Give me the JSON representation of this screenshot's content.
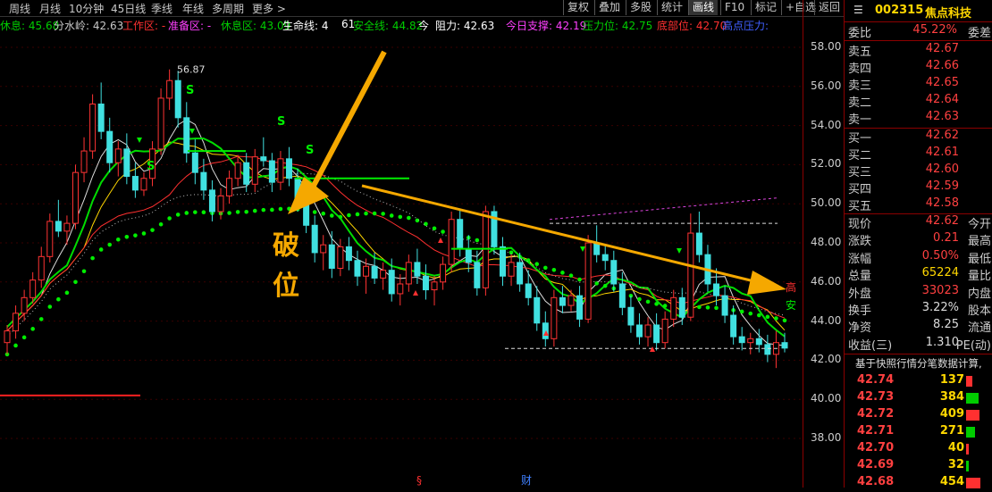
{
  "toolbar": {
    "left": [
      "周线",
      "月线",
      "10分钟",
      "45日线",
      "季线",
      "年线",
      "多周期",
      "更多 >"
    ],
    "right": [
      "复权",
      "叠加",
      "多股",
      "统计",
      "画线",
      "F10",
      "标记",
      "+自选",
      "返回"
    ],
    "active": "画线"
  },
  "indicators": [
    {
      "label": "休息: 45.68",
      "color": "#00cc00"
    },
    {
      "label": "分水岭: 42.63",
      "color": "#c8c8c8"
    },
    {
      "label": "工作区: -",
      "color": "#ff3030"
    },
    {
      "label": "准备区: -",
      "color": "#ff40ff"
    },
    {
      "label": "休息区: 43.09",
      "color": "#00cc00"
    },
    {
      "label": "生命线: 4",
      "color": "#ffffff"
    },
    {
      "label": "61",
      "color": "#ffffff"
    },
    {
      "label": "安全线: 44.82",
      "color": "#00cc00"
    },
    {
      "label": "今",
      "color": "#ffffff"
    },
    {
      "label": "阻力: 42.63",
      "color": "#ffffff"
    },
    {
      "label": "今日支撑: 42.19",
      "color": "#ff40ff"
    },
    {
      "label": "压力位: 42.75",
      "color": "#00cc00"
    },
    {
      "label": "底部位: 42.70",
      "color": "#ff3030"
    },
    {
      "label": "高点压力:",
      "color": "#4060ff"
    }
  ],
  "annotation": {
    "text1": "破",
    "text2": "位",
    "high_label": "高",
    "safe_label": "安"
  },
  "chart_data": {
    "type": "candlestick",
    "ylim": [
      37,
      59
    ],
    "yticks": [
      "58.00",
      "56.00",
      "54.00",
      "52.00",
      "50.00",
      "48.00",
      "46.00",
      "44.00",
      "42.00",
      "40.00",
      "38.00"
    ],
    "high_marker": "56.87",
    "bottom_markers": [
      "§",
      "财"
    ],
    "candles": [
      [
        42.9,
        43.8,
        42.3,
        43.5
      ],
      [
        43.5,
        44.8,
        43.1,
        44.4
      ],
      [
        44.4,
        45.6,
        44.0,
        45.2
      ],
      [
        45.2,
        46.5,
        44.9,
        46.1
      ],
      [
        46.1,
        47.8,
        45.7,
        47.3
      ],
      [
        47.3,
        49.5,
        47.0,
        49.1
      ],
      [
        49.1,
        50.2,
        48.3,
        48.6
      ],
      [
        48.6,
        49.4,
        47.9,
        49.0
      ],
      [
        49.0,
        52.0,
        48.7,
        51.6
      ],
      [
        51.6,
        53.4,
        51.1,
        52.7
      ],
      [
        52.7,
        55.6,
        52.3,
        55.1
      ],
      [
        55.1,
        56.2,
        53.3,
        53.7
      ],
      [
        53.7,
        54.4,
        51.6,
        52.1
      ],
      [
        52.1,
        53.2,
        51.4,
        52.8
      ],
      [
        52.8,
        53.6,
        51.0,
        51.4
      ],
      [
        51.4,
        52.1,
        50.3,
        50.7
      ],
      [
        50.7,
        51.6,
        50.4,
        51.3
      ],
      [
        51.3,
        53.2,
        50.9,
        52.8
      ],
      [
        52.8,
        55.9,
        52.5,
        55.4
      ],
      [
        55.4,
        56.87,
        54.8,
        56.3
      ],
      [
        56.3,
        56.8,
        53.9,
        54.4
      ],
      [
        54.4,
        55.2,
        52.1,
        52.6
      ],
      [
        52.6,
        53.3,
        51.0,
        51.6
      ],
      [
        51.6,
        52.3,
        50.2,
        50.7
      ],
      [
        50.7,
        51.2,
        49.1,
        49.6
      ],
      [
        49.6,
        50.8,
        49.2,
        50.4
      ],
      [
        50.4,
        51.7,
        50.0,
        51.3
      ],
      [
        51.3,
        52.5,
        50.9,
        52.1
      ],
      [
        52.1,
        52.6,
        50.6,
        51.0
      ],
      [
        51.0,
        52.8,
        50.6,
        52.4
      ],
      [
        52.4,
        53.4,
        51.9,
        52.2
      ],
      [
        52.2,
        52.6,
        50.6,
        51.1
      ],
      [
        51.1,
        52.7,
        50.7,
        52.3
      ],
      [
        52.3,
        52.9,
        50.9,
        51.3
      ],
      [
        51.3,
        51.8,
        49.6,
        50.1
      ],
      [
        50.1,
        50.6,
        48.5,
        48.9
      ],
      [
        48.9,
        49.4,
        47.0,
        47.5
      ],
      [
        47.5,
        48.4,
        46.6,
        47.9
      ],
      [
        47.9,
        48.6,
        46.2,
        46.7
      ],
      [
        46.7,
        48.2,
        46.3,
        47.8
      ],
      [
        47.8,
        48.3,
        46.6,
        47.1
      ],
      [
        47.1,
        47.6,
        45.8,
        46.3
      ],
      [
        46.3,
        47.2,
        45.4,
        46.8
      ],
      [
        46.8,
        47.5,
        45.9,
        46.2
      ],
      [
        46.2,
        47.0,
        45.6,
        46.6
      ],
      [
        46.6,
        47.2,
        45.0,
        45.4
      ],
      [
        45.4,
        46.4,
        44.8,
        45.9
      ],
      [
        45.9,
        47.4,
        45.5,
        47.0
      ],
      [
        47.0,
        47.7,
        45.9,
        46.3
      ],
      [
        46.3,
        46.9,
        45.1,
        45.6
      ],
      [
        45.6,
        46.3,
        44.8,
        46.0
      ],
      [
        46.0,
        47.3,
        45.6,
        46.9
      ],
      [
        46.9,
        49.6,
        46.5,
        49.2
      ],
      [
        49.2,
        49.7,
        47.3,
        47.7
      ],
      [
        47.7,
        48.4,
        46.5,
        47.0
      ],
      [
        47.0,
        47.6,
        45.3,
        45.7
      ],
      [
        45.7,
        49.9,
        45.3,
        49.6
      ],
      [
        49.6,
        49.9,
        47.4,
        47.8
      ],
      [
        47.8,
        48.3,
        45.8,
        46.3
      ],
      [
        46.3,
        47.4,
        45.8,
        47.0
      ],
      [
        47.0,
        47.5,
        45.5,
        45.9
      ],
      [
        45.9,
        46.6,
        44.8,
        45.2
      ],
      [
        45.2,
        45.8,
        43.5,
        43.9
      ],
      [
        43.9,
        44.5,
        42.7,
        43.1
      ],
      [
        43.1,
        45.6,
        42.7,
        45.2
      ],
      [
        45.2,
        45.8,
        44.4,
        44.8
      ],
      [
        44.8,
        45.6,
        44.5,
        45.3
      ],
      [
        45.3,
        45.8,
        43.7,
        44.1
      ],
      [
        44.1,
        48.4,
        43.9,
        48.0
      ],
      [
        48.0,
        48.9,
        47.0,
        47.4
      ],
      [
        47.4,
        47.9,
        46.6,
        47.1
      ],
      [
        47.1,
        47.6,
        45.5,
        45.9
      ],
      [
        45.9,
        46.5,
        44.3,
        44.7
      ],
      [
        44.7,
        45.3,
        43.4,
        43.8
      ],
      [
        43.8,
        44.4,
        42.8,
        43.2
      ],
      [
        43.2,
        44.2,
        42.7,
        43.8
      ],
      [
        43.8,
        44.4,
        42.5,
        42.9
      ],
      [
        42.9,
        44.5,
        42.6,
        44.1
      ],
      [
        44.1,
        45.6,
        43.7,
        45.2
      ],
      [
        45.2,
        45.7,
        43.8,
        44.2
      ],
      [
        44.2,
        49.5,
        44.0,
        48.5
      ],
      [
        48.5,
        49.6,
        47.0,
        47.4
      ],
      [
        47.4,
        47.9,
        45.5,
        45.9
      ],
      [
        45.9,
        46.7,
        44.8,
        45.3
      ],
      [
        45.3,
        45.8,
        43.9,
        44.3
      ],
      [
        44.3,
        44.8,
        42.8,
        43.2
      ],
      [
        43.2,
        43.7,
        42.5,
        42.9
      ],
      [
        42.9,
        43.4,
        42.3,
        43.1
      ],
      [
        43.1,
        43.6,
        42.4,
        42.8
      ],
      [
        42.8,
        43.3,
        41.9,
        42.3
      ],
      [
        42.3,
        43.5,
        41.6,
        42.9
      ],
      [
        42.9,
        43.4,
        42.4,
        42.62
      ]
    ]
  },
  "panel": {
    "code": "002315",
    "name": "焦点科技",
    "weibi_label": "委比",
    "weibi": "45.22%",
    "weicha_label": "委差",
    "asks": [
      [
        "卖五",
        "42.67"
      ],
      [
        "卖四",
        "42.66"
      ],
      [
        "卖三",
        "42.65"
      ],
      [
        "卖二",
        "42.64"
      ],
      [
        "卖一",
        "42.63"
      ]
    ],
    "bids": [
      [
        "买一",
        "42.62"
      ],
      [
        "买二",
        "42.61"
      ],
      [
        "买三",
        "42.60"
      ],
      [
        "买四",
        "42.59"
      ],
      [
        "买五",
        "42.58"
      ]
    ],
    "stats": [
      [
        "现价",
        "42.62",
        "今开"
      ],
      [
        "涨跌",
        "0.21",
        "最高"
      ],
      [
        "涨幅",
        "0.50%",
        "最低"
      ],
      [
        "总量",
        "65224",
        "量比"
      ],
      [
        "外盘",
        "33023",
        "内盘"
      ],
      [
        "换手",
        "3.22%",
        "股本"
      ],
      [
        "净资",
        "8.25",
        "流通"
      ],
      [
        "收益(三)",
        "1.310",
        "PE(动)"
      ]
    ],
    "tick_header": "基于快照行情分笔数据计算,",
    "ticks": [
      [
        "42.74",
        "137"
      ],
      [
        "42.73",
        "384"
      ],
      [
        "42.72",
        "409"
      ],
      [
        "42.71",
        "271"
      ],
      [
        "42.70",
        "40"
      ],
      [
        "42.69",
        "32"
      ],
      [
        "42.68",
        "454"
      ]
    ]
  }
}
